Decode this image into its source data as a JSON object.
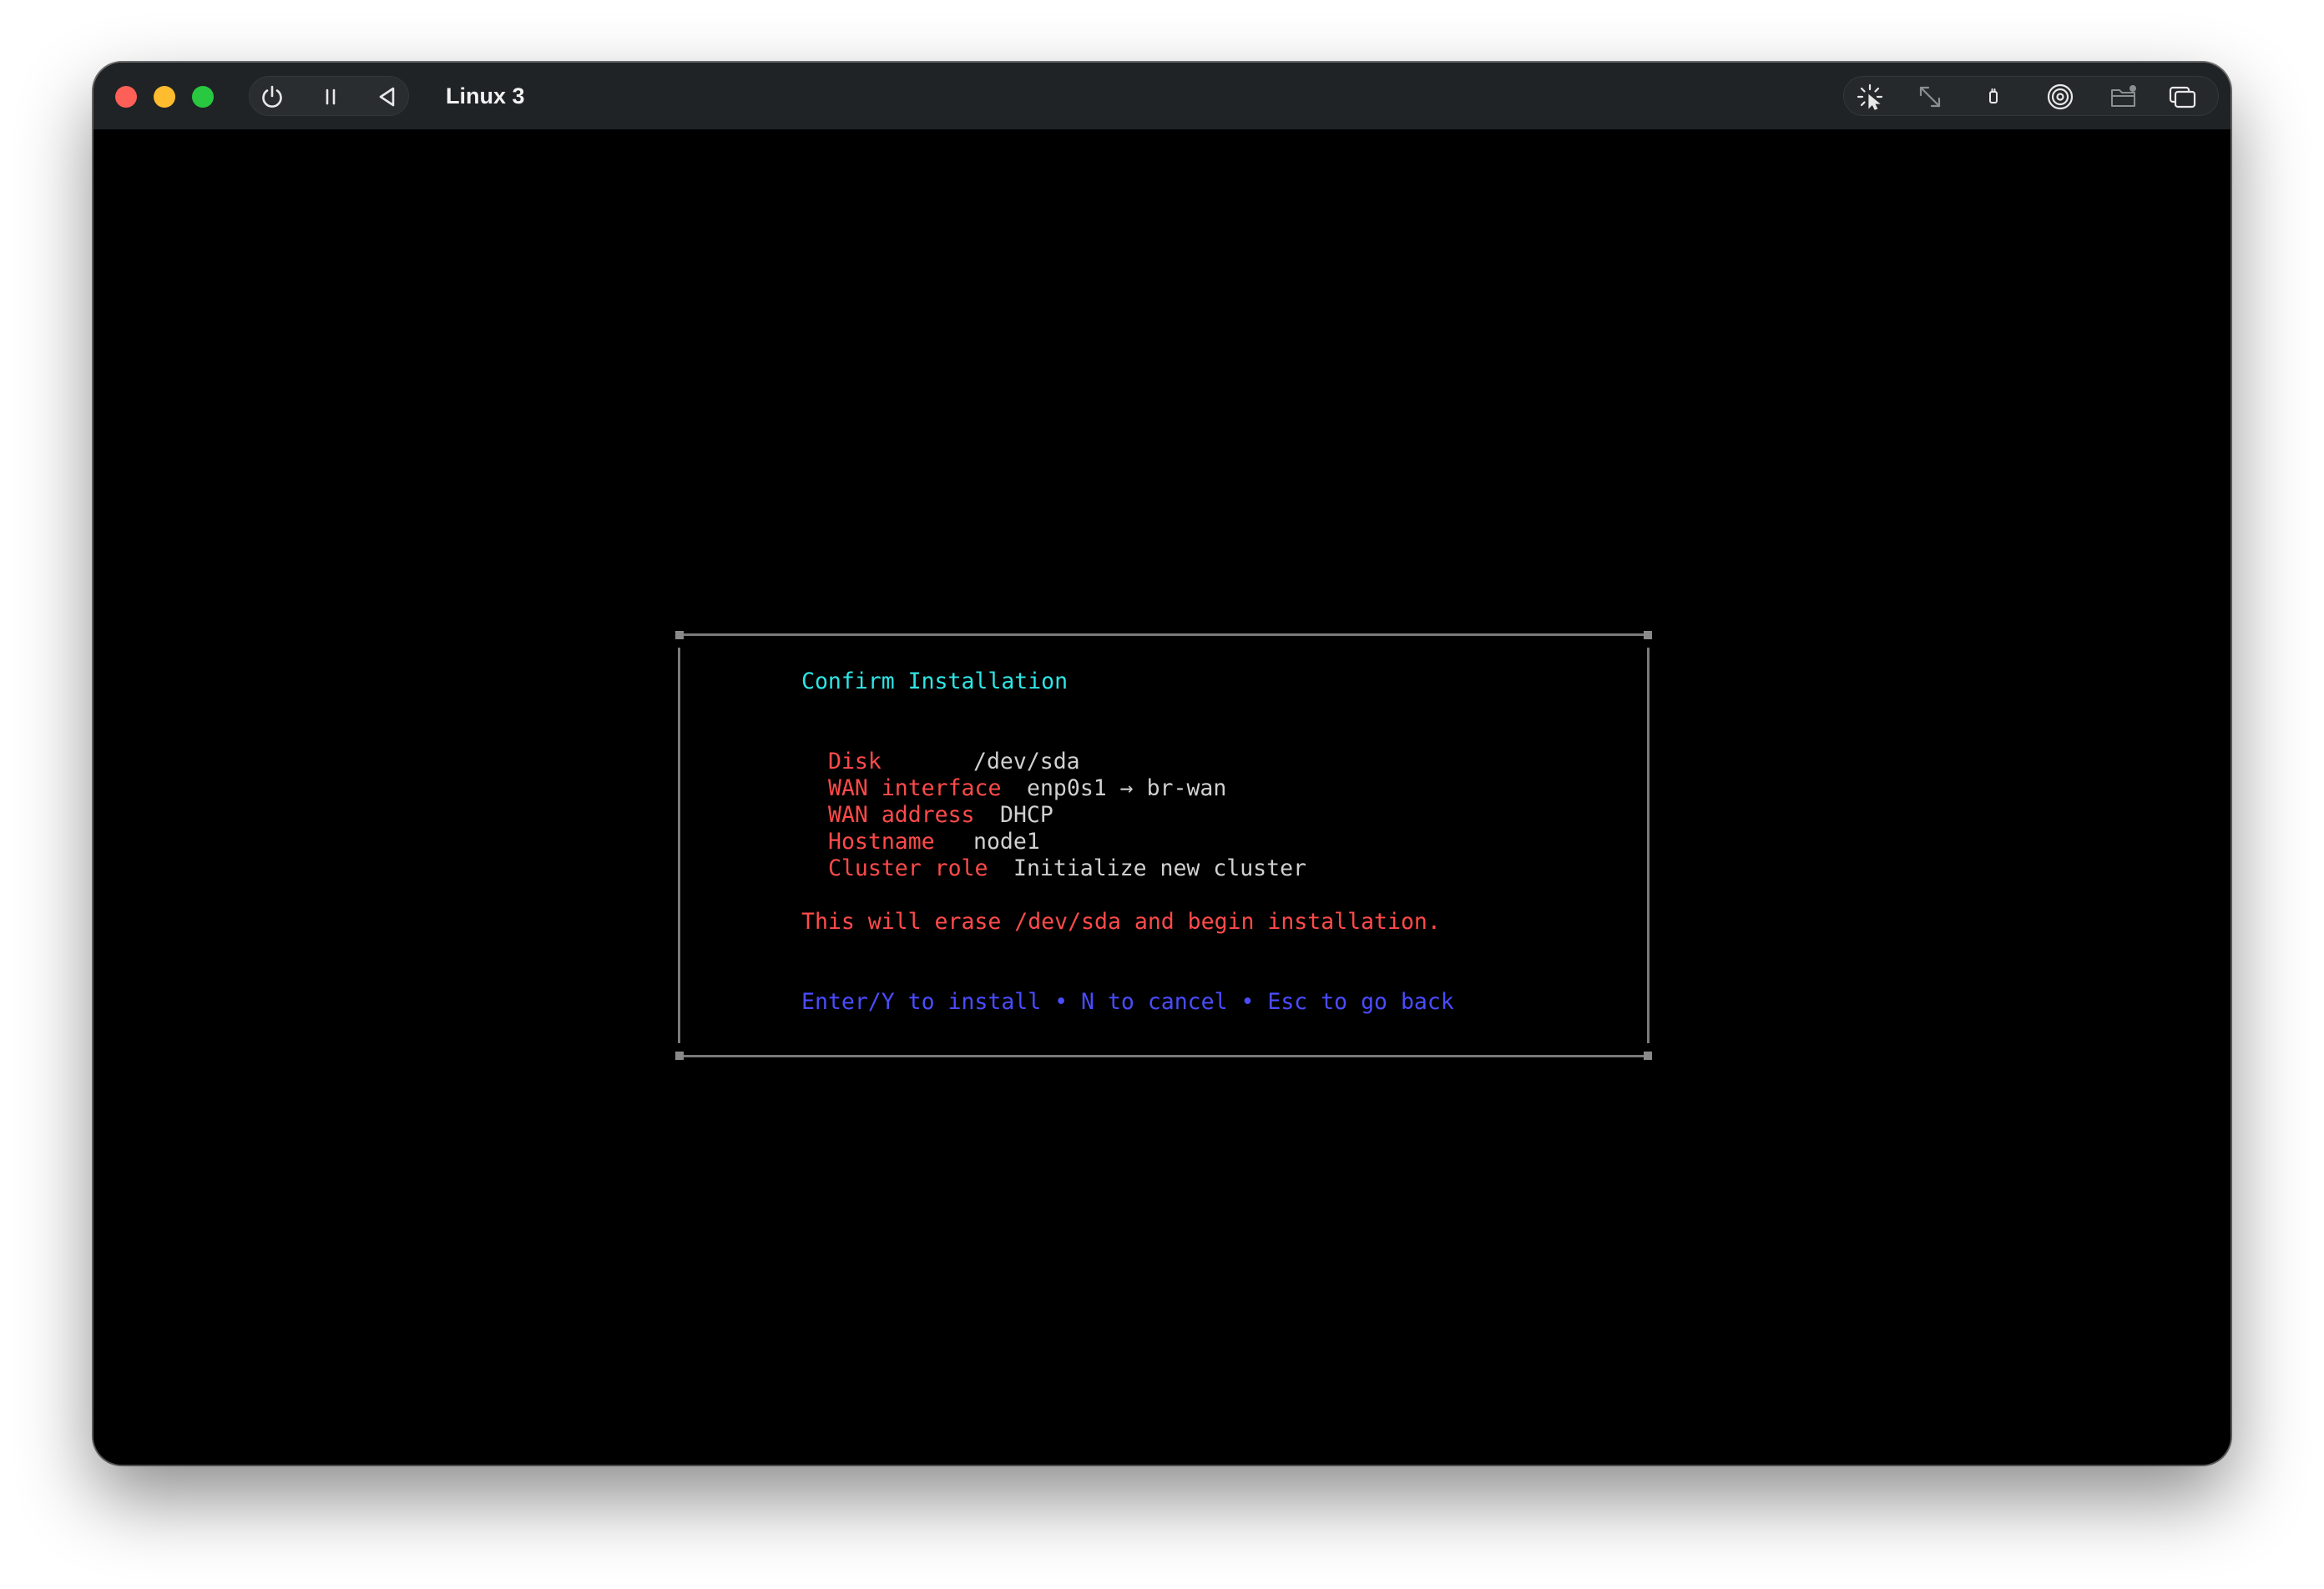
{
  "window": {
    "title": "Linux 3",
    "toolbar_left": [
      "power-icon",
      "pause-icon",
      "back-icon"
    ],
    "toolbar_right": [
      "capture-pointer-icon",
      "resize-icon",
      "usb-icon",
      "disc-icon",
      "shared-folder-icon",
      "display-icon"
    ]
  },
  "dialog": {
    "title": "Confirm Installation",
    "rows": [
      {
        "label": "Disk",
        "value": "/dev/sda"
      },
      {
        "label": "WAN interface",
        "value": "enp0s1 → br-wan"
      },
      {
        "label": "WAN address",
        "value": "DHCP"
      },
      {
        "label": "Hostname",
        "value": "node1"
      },
      {
        "label": "Cluster role",
        "value": "Initialize new cluster"
      }
    ],
    "warning": "This will erase /dev/sda and begin installation.",
    "hint": "Enter/Y to install • N to cancel • Esc to go back"
  },
  "colors": {
    "title": "#2ee6e6",
    "label": "#ff4a4a",
    "value": "#d0d0d0",
    "hint": "#4a4cff",
    "border": "#7a7a7a"
  }
}
